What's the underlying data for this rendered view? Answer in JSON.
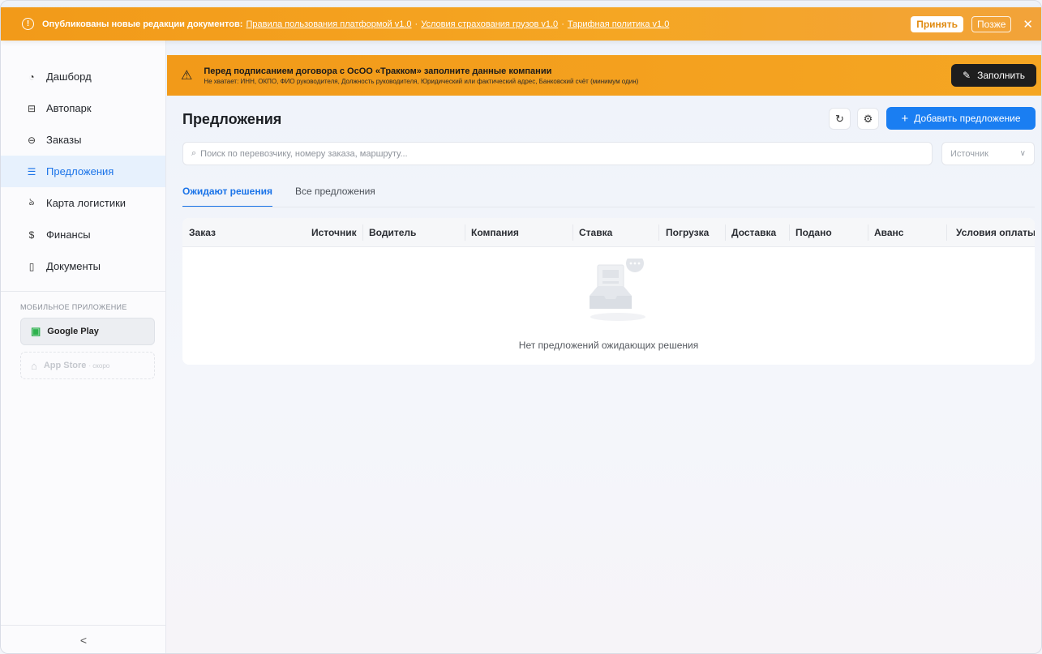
{
  "notification": {
    "title": "Опубликованы новые редакции документов:",
    "links": [
      "Правила пользования платформой v1.0",
      "Условия страхования грузов v1.0",
      "Тарифная политика v1.0"
    ],
    "separator": "·",
    "accept_label": "Принять",
    "later_label": "Позже",
    "close_glyph": "✕"
  },
  "sidebar": {
    "items": [
      {
        "label": "Дашборд",
        "icon": "gauge-icon",
        "glyph": "◔"
      },
      {
        "label": "Автопарк",
        "icon": "truck-icon",
        "glyph": "⊟"
      },
      {
        "label": "Заказы",
        "icon": "box-icon",
        "glyph": "⊖"
      },
      {
        "label": "Предложения",
        "icon": "list-icon",
        "glyph": "☰",
        "active": true
      },
      {
        "label": "Карта логистики",
        "icon": "route-icon",
        "glyph": "ঌ"
      },
      {
        "label": "Финансы",
        "icon": "coin-icon",
        "glyph": "$"
      },
      {
        "label": "Документы",
        "icon": "file-icon",
        "glyph": "▯"
      }
    ],
    "mobile_label": "МОБИЛЬНОЕ ПРИЛОЖЕНИЕ",
    "google_play": "Google Play",
    "app_store": "App Store",
    "app_store_soon": "· скоро",
    "collapse_glyph": "<"
  },
  "warning": {
    "title": "Перед подписанием договора с ОсОО «Тракком» заполните данные компании",
    "subtitle": "Не хватает: ИНН, ОКПО, ФИО руководителя, Должность руководителя, Юридический или фактический адрес, Банковский счёт (минимум один)",
    "fill_label": "Заполнить"
  },
  "main": {
    "title": "Предложения",
    "add_label": "Добавить предложение",
    "search_placeholder": "Поиск по перевозчику, номеру заказа, маршруту...",
    "source_placeholder": "Источник",
    "tabs": [
      {
        "label": "Ожидают решения",
        "active": true
      },
      {
        "label": "Все предложения",
        "active": false
      }
    ],
    "columns": [
      "Заказ",
      "Источник",
      "Водитель",
      "Компания",
      "Ставка",
      "Погрузка",
      "Доставка",
      "Подано",
      "Аванс",
      "Условия оплаты"
    ],
    "empty_text": "Нет предложений ожидающих решения"
  },
  "colors": {
    "accent": "#1a7ef2",
    "warning": "#f5a623",
    "active_bg": "#e7f1fd"
  }
}
